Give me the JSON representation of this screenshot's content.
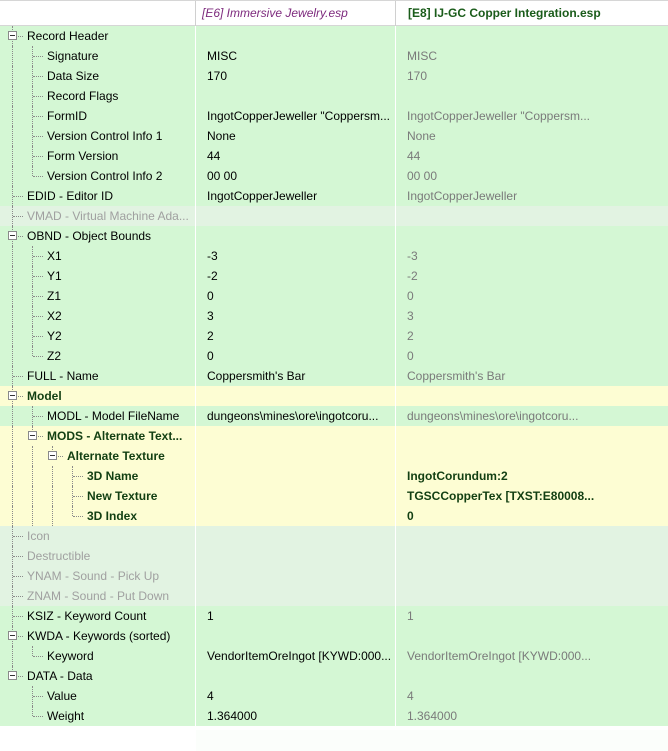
{
  "header": {
    "col0": "",
    "col1": "[E6] Immersive Jewelry.esp",
    "col2": "[E8] IJ-GC Copper Integration.esp"
  },
  "rows": [
    {
      "label": "Record Header",
      "v1": "",
      "v2": "",
      "level": 0,
      "expander": true,
      "bg": "green"
    },
    {
      "label": "Signature",
      "v1": "MISC",
      "v2": "MISC",
      "level": 1,
      "bg": "green"
    },
    {
      "label": "Data Size",
      "v1": "170",
      "v2": "170",
      "level": 1,
      "bg": "green"
    },
    {
      "label": "Record Flags",
      "v1": "",
      "v2": "",
      "level": 1,
      "bg": "green"
    },
    {
      "label": "FormID",
      "v1": "IngotCopperJeweller \"Coppersm...",
      "v2": "IngotCopperJeweller \"Coppersm...",
      "level": 1,
      "bg": "green"
    },
    {
      "label": "Version Control Info 1",
      "v1": "None",
      "v2": "None",
      "level": 1,
      "bg": "green"
    },
    {
      "label": "Form Version",
      "v1": "44",
      "v2": "44",
      "level": 1,
      "bg": "green"
    },
    {
      "label": "Version Control Info 2",
      "v1": "00 00",
      "v2": "00 00",
      "level": 1,
      "bg": "green",
      "last": true
    },
    {
      "label": "EDID - Editor ID",
      "v1": "IngotCopperJeweller",
      "v2": "IngotCopperJeweller",
      "level": 0,
      "bg": "green"
    },
    {
      "label": "VMAD - Virtual Machine Ada...",
      "v1": "",
      "v2": "",
      "level": 0,
      "bg": "gray",
      "disabled": true
    },
    {
      "label": "OBND - Object Bounds",
      "v1": "",
      "v2": "",
      "level": 0,
      "expander": true,
      "bg": "green"
    },
    {
      "label": "X1",
      "v1": "-3",
      "v2": "-3",
      "level": 1,
      "bg": "green"
    },
    {
      "label": "Y1",
      "v1": "-2",
      "v2": "-2",
      "level": 1,
      "bg": "green"
    },
    {
      "label": "Z1",
      "v1": "0",
      "v2": "0",
      "level": 1,
      "bg": "green"
    },
    {
      "label": "X2",
      "v1": "3",
      "v2": "3",
      "level": 1,
      "bg": "green"
    },
    {
      "label": "Y2",
      "v1": "2",
      "v2": "2",
      "level": 1,
      "bg": "green"
    },
    {
      "label": "Z2",
      "v1": "0",
      "v2": "0",
      "level": 1,
      "bg": "green",
      "last": true
    },
    {
      "label": "FULL - Name",
      "v1": "Coppersmith's Bar",
      "v2": "Coppersmith's Bar",
      "level": 0,
      "bg": "green"
    },
    {
      "label": "Model",
      "v1": "",
      "v2": "",
      "level": 0,
      "expander": true,
      "bg": "yellow",
      "bold": true
    },
    {
      "label": "MODL - Model FileName",
      "v1": "dungeons\\mines\\ore\\ingotcoru...",
      "v2": "dungeons\\mines\\ore\\ingotcoru...",
      "level": 1,
      "bg": "green"
    },
    {
      "label": "MODS - Alternate Text...",
      "v1": "",
      "v2": "",
      "level": 1,
      "expander": true,
      "bg": "yellow",
      "bold": true,
      "last": true
    },
    {
      "label": "Alternate Texture",
      "v1": "",
      "v2": "",
      "level": 2,
      "expander": true,
      "bg": "yellow",
      "bold": true,
      "last": true
    },
    {
      "label": "3D Name",
      "v1": "",
      "v2": "IngotCorundum:2",
      "level": 3,
      "bg": "yellow",
      "bold": true
    },
    {
      "label": "New Texture",
      "v1": "",
      "v2": "TGSCCopperTex [TXST:E80008...",
      "level": 3,
      "bg": "yellow",
      "bold": true
    },
    {
      "label": "3D Index",
      "v1": "",
      "v2": "0",
      "level": 3,
      "bg": "yellow",
      "bold": true,
      "last": true
    },
    {
      "label": "Icon",
      "v1": "",
      "v2": "",
      "level": 0,
      "bg": "gray",
      "disabled": true
    },
    {
      "label": "Destructible",
      "v1": "",
      "v2": "",
      "level": 0,
      "bg": "gray",
      "disabled": true
    },
    {
      "label": "YNAM - Sound - Pick Up",
      "v1": "",
      "v2": "",
      "level": 0,
      "bg": "gray",
      "disabled": true
    },
    {
      "label": "ZNAM - Sound - Put Down",
      "v1": "",
      "v2": "",
      "level": 0,
      "bg": "gray",
      "disabled": true
    },
    {
      "label": "KSIZ - Keyword Count",
      "v1": "1",
      "v2": "1",
      "level": 0,
      "bg": "green"
    },
    {
      "label": "KWDA - Keywords (sorted)",
      "v1": "",
      "v2": "",
      "level": 0,
      "expander": true,
      "bg": "green"
    },
    {
      "label": "Keyword",
      "v1": "VendorItemOreIngot [KYWD:000...",
      "v2": "VendorItemOreIngot [KYWD:000...",
      "level": 1,
      "bg": "green",
      "last": true
    },
    {
      "label": "DATA - Data",
      "v1": "",
      "v2": "",
      "level": 0,
      "expander": true,
      "bg": "green",
      "last0": true
    },
    {
      "label": "Value",
      "v1": "4",
      "v2": "4",
      "level": 1,
      "bg": "green",
      "lastParent": true
    },
    {
      "label": "Weight",
      "v1": "1.364000",
      "v2": "1.364000",
      "level": 1,
      "bg": "green",
      "last": true,
      "lastParent": true
    }
  ]
}
